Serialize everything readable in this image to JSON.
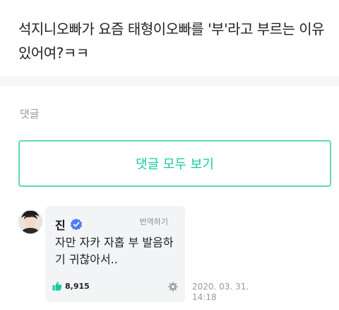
{
  "post": {
    "text": "석지니오빠가 요즘 태형이오빠를 '부'라고 부르는 이유 있어여?ㅋㅋ"
  },
  "comments_section": {
    "label": "댓글",
    "view_all_button": "댓글 모두 보기"
  },
  "comment": {
    "author": "진",
    "translate_label": "번역하기",
    "text": "자만 자카 자홉 부 발음하기 귀찮아서..",
    "like_count": "8,915",
    "timestamp_line1": "2020. 03. 31.",
    "timestamp_line2": "14:18",
    "icons": {
      "verified": "verified-badge-icon",
      "like": "thumbs-up-icon",
      "settings": "gear-icon"
    }
  },
  "colors": {
    "accent": "#17c9a2",
    "accent_border": "#5fdcb3",
    "verified": "#4a7cf7",
    "muted": "#9a9a9a",
    "bubble_bg": "#f3f4f6"
  }
}
